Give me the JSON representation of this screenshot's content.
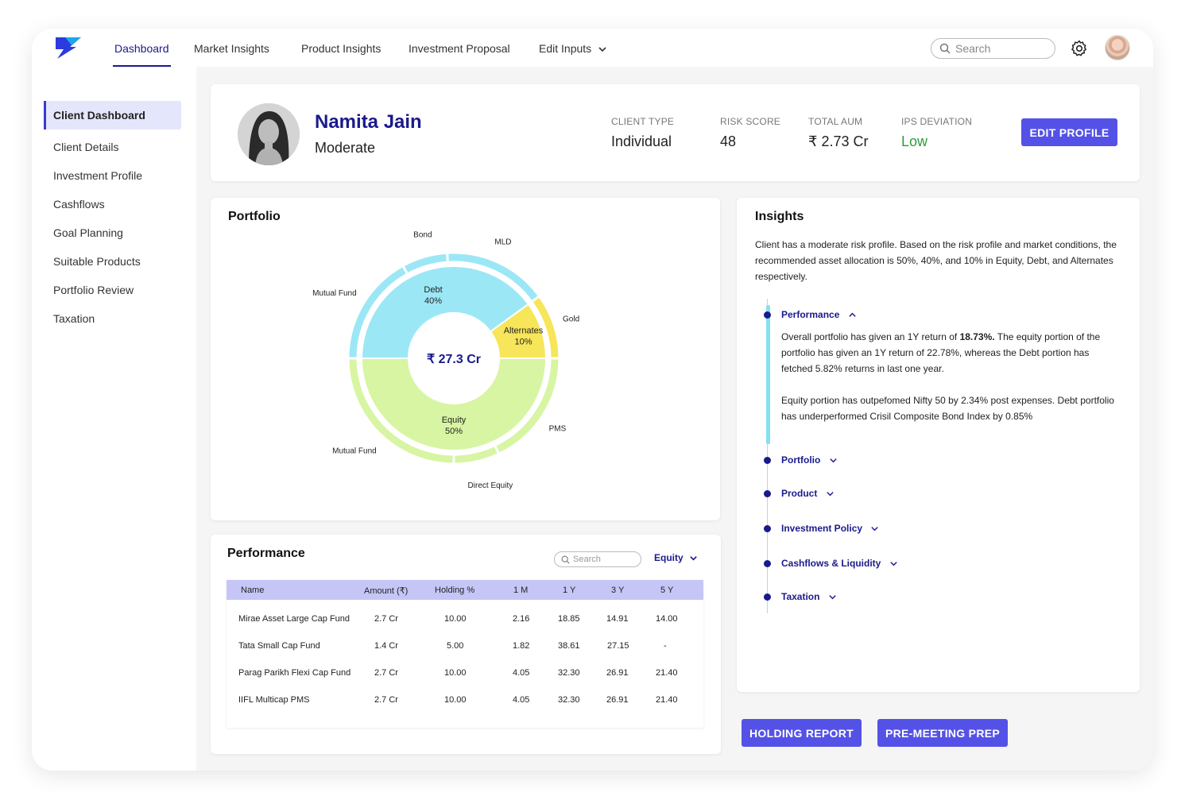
{
  "nav": {
    "items": [
      "Dashboard",
      "Market Insights",
      "Product Insights",
      "Investment Proposal",
      "Edit Inputs"
    ],
    "search_placeholder": "Search"
  },
  "sidebar": {
    "items": [
      "Client Dashboard",
      "Client Details",
      "Investment Profile",
      "Cashflows",
      "Goal Planning",
      "Suitable Products",
      "Portfolio Review",
      "Taxation"
    ]
  },
  "client": {
    "name": "Namita Jain",
    "risk_profile": "Moderate",
    "stats": [
      {
        "label": "CLIENT TYPE",
        "value": "Individual"
      },
      {
        "label": "RISK SCORE",
        "value": "48"
      },
      {
        "label": "TOTAL AUM",
        "value": "₹ 2.73 Cr"
      },
      {
        "label": "IPS DEVIATION",
        "value": "Low"
      }
    ],
    "edit_button": "EDIT PROFILE"
  },
  "portfolio": {
    "title": "Portfolio",
    "center_label": "₹ 27.3 Cr"
  },
  "chart_data": {
    "type": "pie",
    "center_label": "₹ 27.3 Cr",
    "inner": [
      {
        "label": "Equity",
        "value": 50,
        "display": "50%",
        "color": "#d7f5a2"
      },
      {
        "label": "Debt",
        "value": 40,
        "display": "40%",
        "color": "#9ce7f5"
      },
      {
        "label": "Alternates",
        "value": 10,
        "display": "10%",
        "color": "#f7e55a"
      }
    ],
    "outer": [
      {
        "label": "PMS",
        "parent": "Equity",
        "value": 18,
        "color": "#d7f5a2"
      },
      {
        "label": "Direct Equity",
        "parent": "Equity",
        "value": 7,
        "color": "#d7f5a2"
      },
      {
        "label": "Mutual Fund",
        "parent": "Equity",
        "value": 25,
        "color": "#d7f5a2"
      },
      {
        "label": "Mutual Fund",
        "parent": "Debt",
        "value": 17,
        "color": "#9ce7f5"
      },
      {
        "label": "Bond",
        "parent": "Debt",
        "value": 7,
        "color": "#9ce7f5"
      },
      {
        "label": "MLD",
        "parent": "Debt",
        "value": 16,
        "color": "#9ce7f5"
      },
      {
        "label": "Gold",
        "parent": "Alternates",
        "value": 10,
        "color": "#f7e55a"
      }
    ]
  },
  "performance": {
    "title": "Performance",
    "search_placeholder": "Search",
    "filter": "Equity",
    "columns": [
      "Name",
      "Amount (₹)",
      "Holding %",
      "1 M",
      "1 Y",
      "3 Y",
      "5 Y"
    ],
    "rows": [
      [
        "Mirae Asset Large Cap Fund",
        "2.7 Cr",
        "10.00",
        "2.16",
        "18.85",
        "14.91",
        "14.00"
      ],
      [
        "Tata Small Cap Fund",
        "1.4 Cr",
        "5.00",
        "1.82",
        "38.61",
        "27.15",
        "-"
      ],
      [
        "Parag Parikh Flexi Cap Fund",
        "2.7 Cr",
        "10.00",
        "4.05",
        "32.30",
        "26.91",
        "21.40"
      ],
      [
        "IIFL Multicap PMS",
        "2.7 Cr",
        "10.00",
        "4.05",
        "32.30",
        "26.91",
        "21.40"
      ]
    ]
  },
  "insights": {
    "title": "Insights",
    "summary": "Client has a moderate risk profile. Based on the risk profile and market conditions, the recommended asset allocation is 50%, 40%, and 10% in Equity, Debt, and Alternates respectively.",
    "sections": [
      "Performance",
      "Portfolio",
      "Product",
      "Investment Policy",
      "Cashflows & Liquidity",
      "Taxation"
    ],
    "performance_detail": {
      "p1_pre": "Overall portfolio has given an 1Y return of ",
      "p1_bold": "18.73%.",
      "p1_post": " The equity portion of the portfolio has given an 1Y return of 22.78%, whereas the Debt portion has fetched 5.82% returns in last one year.",
      "p2": "Equity portion has outpefomed Nifty 50 by 2.34% post expenses. Debt portfolio has underperformed Crisil Composite Bond Index by 0.85%"
    }
  },
  "actions": {
    "holding_report": "HOLDING REPORT",
    "pre_meeting": "PRE-MEETING PREP"
  },
  "colors": {
    "brand": "#1a1a8c",
    "button": "#5452e6",
    "equity": "#d7f5a2",
    "debt": "#9ce7f5",
    "alternates": "#f7e55a",
    "low_status": "#2e9a3a"
  }
}
